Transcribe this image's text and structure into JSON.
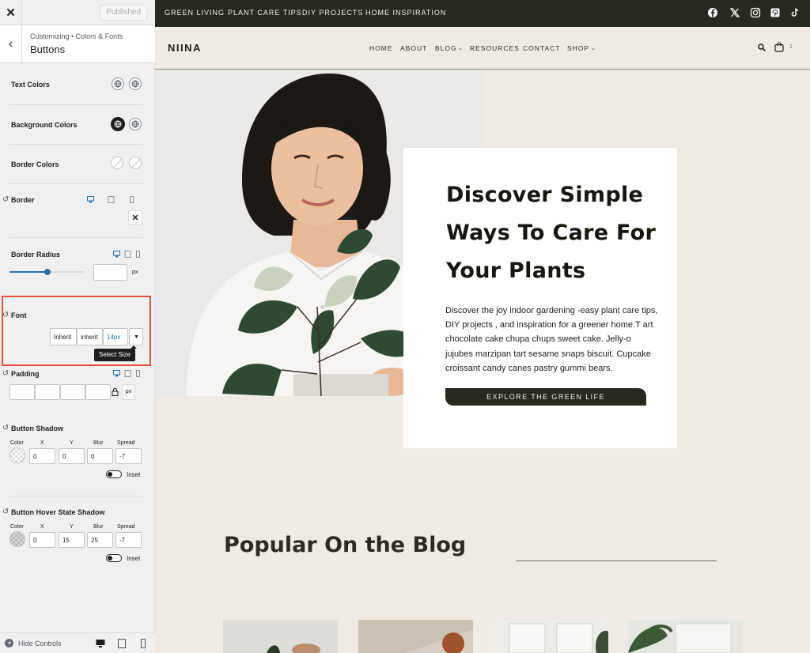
{
  "customizer": {
    "published_label": "Published",
    "breadcrumb": "Customizing • Colors & Fonts",
    "section_title": "Buttons",
    "text_colors_label": "Text Colors",
    "background_colors_label": "Background Colors",
    "border_colors_label": "Border Colors",
    "border_label": "Border",
    "border_radius_label": "Border Radius",
    "border_radius_slider_value": 0.5,
    "border_radius_unit": "px",
    "font_label": "Font",
    "font_family_value": "Inherit",
    "font_weight_value": "inherit",
    "font_size_value": "14px",
    "select_size_tooltip": "Select Size",
    "padding_label": "Padding",
    "padding_unit": "px",
    "button_shadow": {
      "label": "Button Shadow",
      "color_label": "Color",
      "x_label": "X",
      "y_label": "Y",
      "blur_label": "Blur",
      "spread_label": "Spread",
      "x": "0",
      "y": "0",
      "blur": "0",
      "spread": "-7",
      "inset_label": "Inset"
    },
    "button_hover_shadow": {
      "label": "Button Hover State Shadow",
      "color_label": "Color",
      "x_label": "X",
      "y_label": "Y",
      "blur_label": "Blur",
      "spread_label": "Spread",
      "x": "0",
      "y": "15",
      "blur": "25",
      "spread": "-7",
      "inset_label": "Inset"
    },
    "hide_controls_label": "Hide Controls"
  },
  "site": {
    "topbar_links": [
      "GREEN LIVING",
      "PLANT CARE TIPS",
      "DIY PROJECTS",
      "HOME INSPIRATION"
    ],
    "social_icons": [
      "facebook-icon",
      "x-icon",
      "instagram-icon",
      "pinterest-icon",
      "tiktok-icon"
    ],
    "logo": "NIINA",
    "nav": [
      "HOME",
      "ABOUT",
      "BLOG",
      "RESOURCES",
      "CONTACT",
      "SHOP"
    ],
    "cart_count": "1",
    "hero_title": "Discover Simple Ways To Care For Your Plants",
    "hero_text": "Discover the joy indoor gardening -easy plant care tips, DIY projects , and inspiration for a greener home.T art chocolate cake chupa chups sweet cake. Jelly-o jujubes marzipan tart sesame snaps biscuit. Cupcake croissant candy canes pastry gummi bears.",
    "hero_button": "EXPLORE THE GREEN LIFE",
    "blog_title": "Popular On the Blog"
  },
  "colors": {
    "topbar_bg": "#272a1f",
    "page_bg": "#efebe4",
    "highlight": "#e5503c",
    "accent_blue": "#2271b1"
  }
}
